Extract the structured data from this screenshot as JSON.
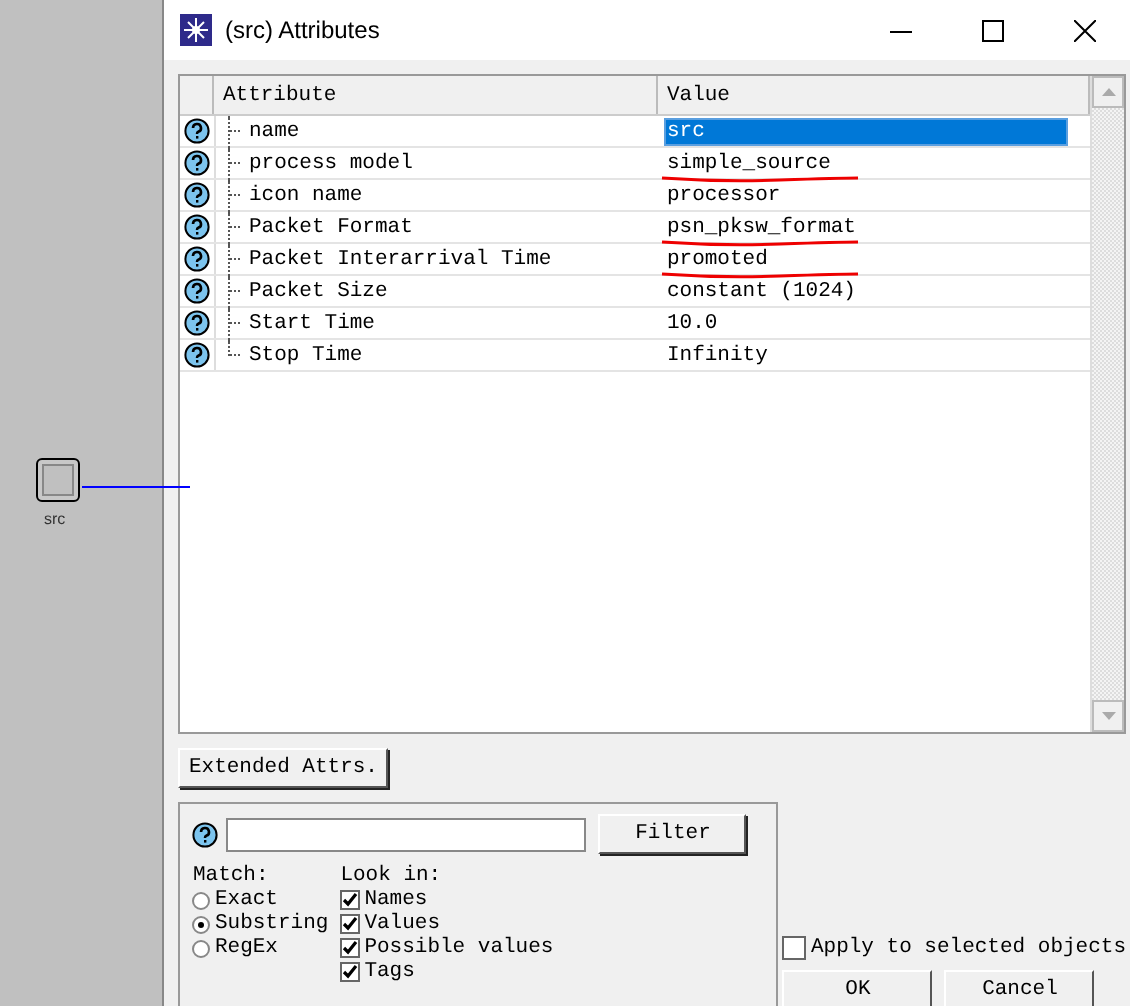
{
  "canvas": {
    "node": {
      "label": "src"
    }
  },
  "window": {
    "title": "(src) Attributes"
  },
  "table": {
    "columns": [
      "Attribute",
      "Value"
    ],
    "rows": [
      {
        "attribute": "name",
        "value": "src",
        "selected": true,
        "underlined": false
      },
      {
        "attribute": "process model",
        "value": "simple_source",
        "selected": false,
        "underlined": true
      },
      {
        "attribute": "icon name",
        "value": "processor",
        "selected": false,
        "underlined": false
      },
      {
        "attribute": "Packet Format",
        "value": "psn_pksw_format",
        "selected": false,
        "underlined": true
      },
      {
        "attribute": "Packet Interarrival Time",
        "value": "promoted",
        "selected": false,
        "underlined": true
      },
      {
        "attribute": "Packet Size",
        "value": "constant (1024)",
        "selected": false,
        "underlined": false
      },
      {
        "attribute": "Start Time",
        "value": "10.0",
        "selected": false,
        "underlined": false
      },
      {
        "attribute": "Stop Time",
        "value": "Infinity",
        "selected": false,
        "underlined": false
      }
    ]
  },
  "extended_button": "Extended Attrs.",
  "filter": {
    "button": "Filter",
    "match_label": "Match:",
    "match_options": [
      {
        "label": "Exact",
        "selected": false
      },
      {
        "label": "Substring",
        "selected": true
      },
      {
        "label": "RegEx",
        "selected": false
      }
    ],
    "look_in_label": "Look in:",
    "look_in": [
      {
        "label": "Names",
        "checked": true
      },
      {
        "label": "Values",
        "checked": true
      },
      {
        "label": "Possible values",
        "checked": true
      },
      {
        "label": "Tags",
        "checked": true
      }
    ]
  },
  "apply": {
    "label": "Apply to selected objects",
    "checked": false
  },
  "buttons": [
    "OK",
    "Cancel"
  ]
}
